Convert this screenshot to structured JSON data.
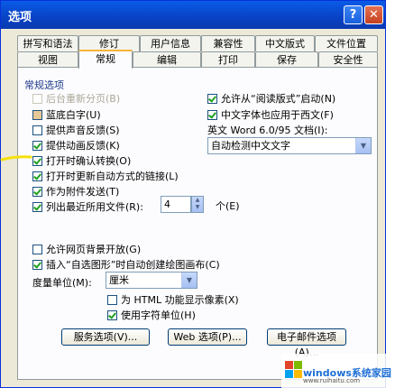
{
  "window": {
    "title": "选项",
    "help": "?",
    "close": "✕"
  },
  "tabs_row1": [
    "拼写和语法",
    "修订",
    "用户信息",
    "兼容性",
    "中文版式",
    "文件位置"
  ],
  "tabs_row2": [
    "视图",
    "常规",
    "编辑",
    "打印",
    "保存",
    "安全性"
  ],
  "active_tab": "常规",
  "group_label": "常规选项",
  "left_options": [
    {
      "label": "后台重新分页(B)",
      "checked": false,
      "disabled": true
    },
    {
      "label": "蓝底白字(U)",
      "checked": false,
      "disabled": false,
      "filled": true
    },
    {
      "label": "提供声音反馈(S)",
      "checked": false,
      "disabled": false
    },
    {
      "label": "提供动画反馈(K)",
      "checked": true,
      "disabled": false
    },
    {
      "label": "打开时确认转换(O)",
      "checked": true,
      "disabled": false
    },
    {
      "label": "打开时更新自动方式的链接(L)",
      "checked": true,
      "disabled": false
    },
    {
      "label": "作为附件发送(T)",
      "checked": true,
      "disabled": false
    },
    {
      "label": "列出最近所用文件(R):",
      "checked": true,
      "disabled": false
    }
  ],
  "right_options": [
    {
      "label": "允许从“阅读版式”启动(N)",
      "checked": true
    },
    {
      "label": "中文字体也应用于西文(F)",
      "checked": true
    }
  ],
  "word_label": "英文 Word 6.0/95 文档(I):",
  "word_select": "自动检测中文文字",
  "recent_count": "4",
  "recent_unit": "个(E)",
  "bg_option": {
    "label": "允许网页背景开放(G)",
    "checked": false
  },
  "autoshape_option": {
    "label": "插入“自选图形”时自动创建绘图画布(C)",
    "checked": true
  },
  "measure_label": "度量单位(M):",
  "measure_value": "厘米",
  "html_option": {
    "label": "为 HTML 功能显示像素(X)",
    "checked": false
  },
  "char_option": {
    "label": "使用字符单位(H)",
    "checked": true
  },
  "buttons": [
    "服务选项(V)...",
    "Web 选项(P)...",
    "电子邮件选项(A)..."
  ],
  "watermark": {
    "text": "windows系统家园",
    "sub": "www.ruihaitu.com"
  },
  "colors": {
    "titlebar": "#0842c4",
    "highlight": "#f5e10a",
    "tab_active_border": "#f8b23a"
  }
}
